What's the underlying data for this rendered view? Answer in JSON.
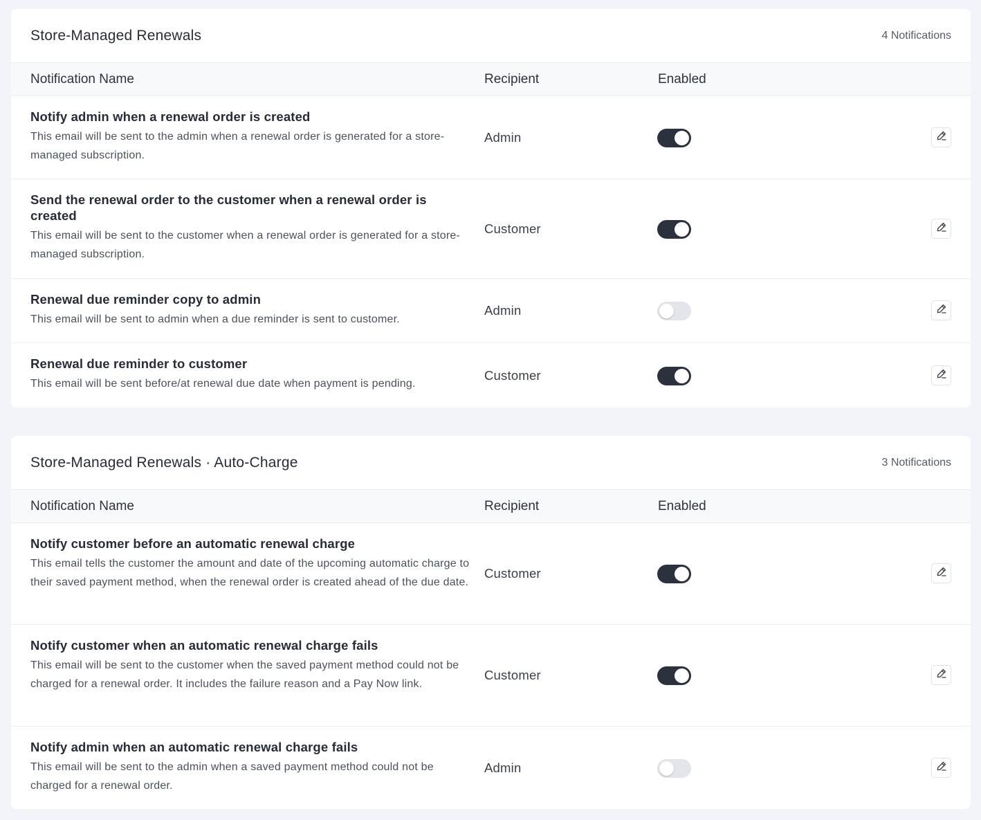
{
  "colors": {
    "page_bg": "#f2f4f9",
    "toggle_on": "#2b313d",
    "toggle_off": "#e3e5ea"
  },
  "sections": [
    {
      "title": "Store-Managed Renewals",
      "count": "4 Notifications",
      "columns": {
        "name": "Notification Name",
        "recipient": "Recipient",
        "enabled": "Enabled"
      },
      "rows": [
        {
          "title": "Notify admin when a renewal order is created",
          "description": "This email will be sent to the admin when a renewal order is generated for a store-managed subscription.",
          "recipient": "Admin",
          "enabled": true,
          "edit_icon": "pencil-icon"
        },
        {
          "title": "Send the renewal order to the customer when a renewal order is created",
          "description": "This email will be sent to the customer when a renewal order is generated for a store-managed subscription.",
          "recipient": "Customer",
          "enabled": true,
          "edit_icon": "pencil-icon"
        },
        {
          "title": "Renewal due reminder copy to admin",
          "description": "This email will be sent to admin when a due reminder is sent to customer.",
          "recipient": "Admin",
          "enabled": false,
          "edit_icon": "pencil-icon"
        },
        {
          "title": "Renewal due reminder to customer",
          "description": "This email will be sent before/at renewal due date when payment is pending.",
          "recipient": "Customer",
          "enabled": true,
          "edit_icon": "pencil-icon"
        }
      ]
    },
    {
      "title": "Store-Managed Renewals · Auto-Charge",
      "count": "3 Notifications",
      "columns": {
        "name": "Notification Name",
        "recipient": "Recipient",
        "enabled": "Enabled"
      },
      "rows": [
        {
          "title": "Notify customer before an automatic renewal charge",
          "description": "This email tells the customer the amount and date of the upcoming automatic charge to their saved payment method, when the renewal order is created ahead of the due date.",
          "recipient": "Customer",
          "enabled": true,
          "edit_icon": "pencil-icon"
        },
        {
          "title": "Notify customer when an automatic renewal charge fails",
          "description": "This email will be sent to the customer when the saved payment method could not be charged for a renewal order. It includes the failure reason and a Pay Now link.",
          "recipient": "Customer",
          "enabled": true,
          "edit_icon": "pencil-icon"
        },
        {
          "title": "Notify admin when an automatic renewal charge fails",
          "description": "This email will be sent to the admin when a saved payment method could not be charged for a renewal order.",
          "recipient": "Admin",
          "enabled": false,
          "edit_icon": "pencil-icon"
        }
      ]
    }
  ]
}
